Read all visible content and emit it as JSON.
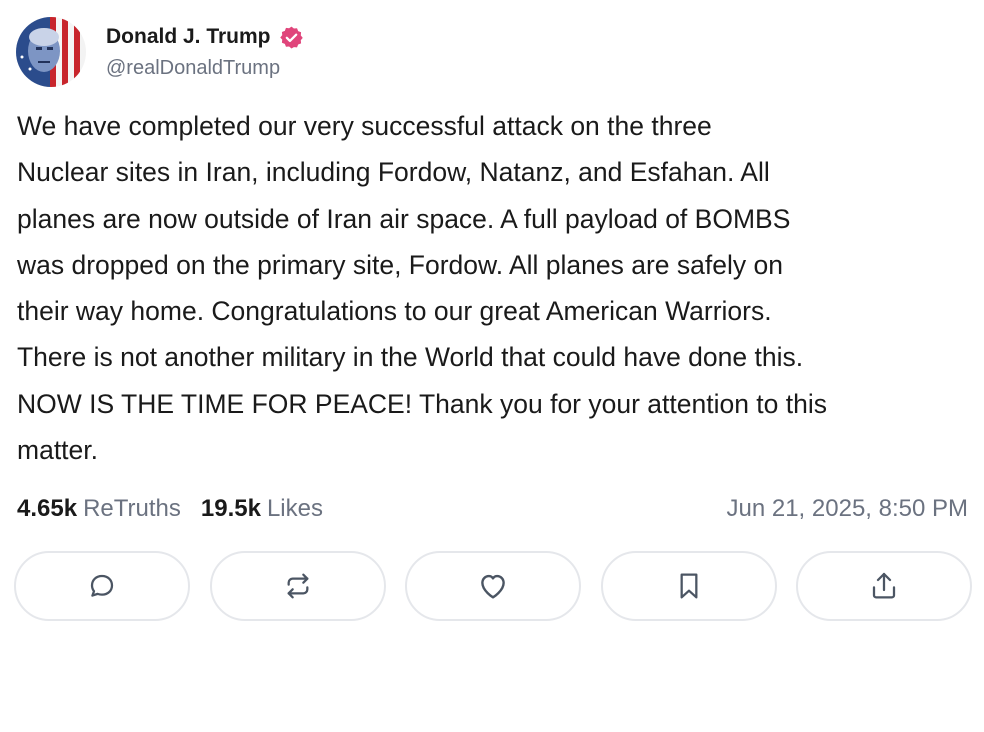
{
  "author": {
    "display_name": "Donald J. Trump",
    "handle": "@realDonaldTrump",
    "verified_icon": "verified-badge-icon",
    "verified_color": "#e0457b"
  },
  "post": {
    "text": "We have completed our very successful attack on the three\nNuclear sites in Iran, including Fordow, Natanz, and Esfahan. All\nplanes are now outside of Iran air space. A full payload of BOMBS\nwas dropped on the primary site, Fordow. All planes are safely on\ntheir way home. Congratulations to our great American Warriors.\nThere is not another military in the World that could have done this.\nNOW IS THE TIME FOR PEACE! Thank you for your attention to this\nmatter."
  },
  "stats": {
    "retruths_count": "4.65k",
    "retruths_label": "ReTruths",
    "likes_count": "19.5k",
    "likes_label": "Likes",
    "timestamp": "Jun 21, 2025, 8:50 PM"
  },
  "actions": [
    {
      "icon": "reply-icon"
    },
    {
      "icon": "retruth-icon"
    },
    {
      "icon": "like-icon"
    },
    {
      "icon": "bookmark-icon"
    },
    {
      "icon": "share-icon"
    }
  ],
  "colors": {
    "text": "#1a1a1a",
    "muted": "#6b7280",
    "button_border": "#e5e7eb",
    "icon": "#4b5563"
  }
}
